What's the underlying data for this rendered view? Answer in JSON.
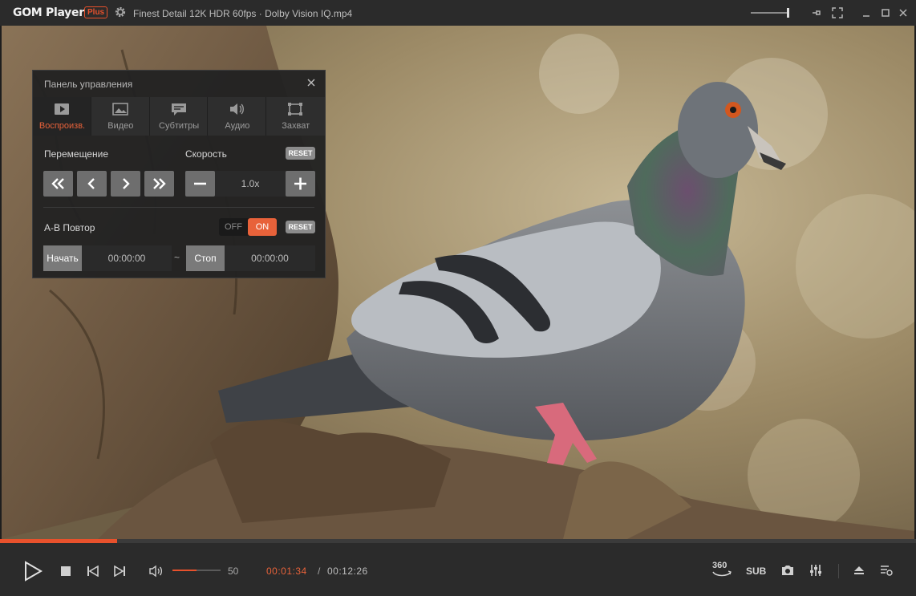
{
  "app": {
    "logo_text": "GOM Player",
    "plus_badge": "Plus",
    "filename": "Finest Detail 12K HDR 60fps · Dolby Vision IQ.mp4"
  },
  "titlebar_icons": [
    "gear-icon",
    "pin-icon",
    "fullscreen-icon",
    "minimize-icon",
    "maximize-icon",
    "close-icon"
  ],
  "panel": {
    "title": "Панель управления",
    "tabs": [
      {
        "label": "Воспроизв.",
        "icon": "play-icon",
        "active": true
      },
      {
        "label": "Видео",
        "icon": "image-icon",
        "active": false
      },
      {
        "label": "Субтитры",
        "icon": "subtitles-icon",
        "active": false
      },
      {
        "label": "Аудио",
        "icon": "speaker-icon",
        "active": false
      },
      {
        "label": "Захват",
        "icon": "capture-icon",
        "active": false
      }
    ],
    "seek_label": "Перемещение",
    "speed_label": "Скорость",
    "speed_reset": "RESET",
    "speed_value": "1.0x",
    "ab_label": "A-B Повтор",
    "toggle_off": "OFF",
    "toggle_on": "ON",
    "ab_reset": "RESET",
    "start_label": "Начать",
    "start_time": "00:00:00",
    "tilde": "~",
    "stop_label": "Стоп",
    "stop_time": "00:00:00"
  },
  "player": {
    "progress": 0.128,
    "volume": 50,
    "volume_text": "50",
    "time_current": "00:01:34",
    "time_separator": "/",
    "time_total": "00:12:26",
    "label_360": "360",
    "label_sub": "SUB"
  },
  "colors": {
    "accent": "#e8512c",
    "accent_text": "#e8623a",
    "titlebar": "#2b2b2b",
    "panel_bg": "#222222"
  }
}
